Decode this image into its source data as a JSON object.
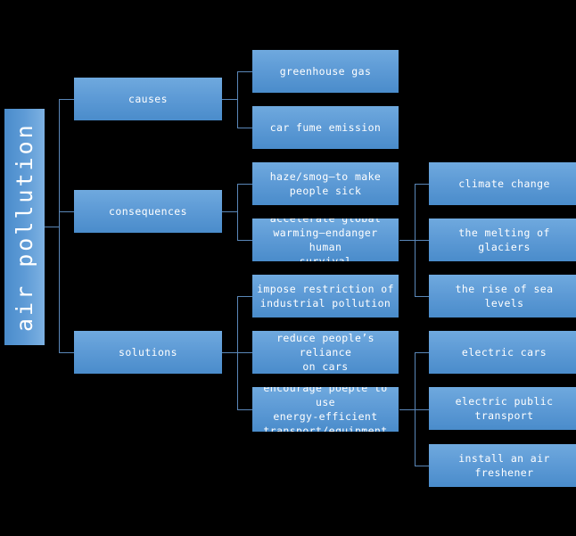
{
  "diagram": {
    "type": "mind-map",
    "title": "air pollution",
    "background_color": "#000000",
    "node_color": "#5e9bd6",
    "node_text_color": "#ffffff",
    "connector_color": "#5a87b8"
  },
  "root": {
    "label": "air pollution",
    "orientation": "vertical-bottom-to-top"
  },
  "branches": [
    {
      "label": "causes",
      "children": [
        {
          "label": "greenhouse gas",
          "children": []
        },
        {
          "label": "car fume emission",
          "children": []
        }
      ]
    },
    {
      "label": "consequences",
      "children": [
        {
          "label": "haze/smog—to make\npeople sick",
          "children": []
        },
        {
          "label": "accelerate global\nwarming—endanger human\nsurvival",
          "children": [
            {
              "label": "climate change"
            },
            {
              "label": "the melting of glaciers"
            },
            {
              "label": "the rise of sea levels"
            }
          ]
        }
      ]
    },
    {
      "label": "solutions",
      "children": [
        {
          "label": "impose restriction of\nindustrial pollution",
          "children": []
        },
        {
          "label": "reduce people’s reliance\non cars",
          "children": []
        },
        {
          "label": "encourage poeple to use\nenergy-efficient\ntransport/equipment",
          "children": [
            {
              "label": "electric cars"
            },
            {
              "label": "electric public\ntransport"
            },
            {
              "label": "install an air freshener"
            }
          ]
        }
      ]
    }
  ]
}
